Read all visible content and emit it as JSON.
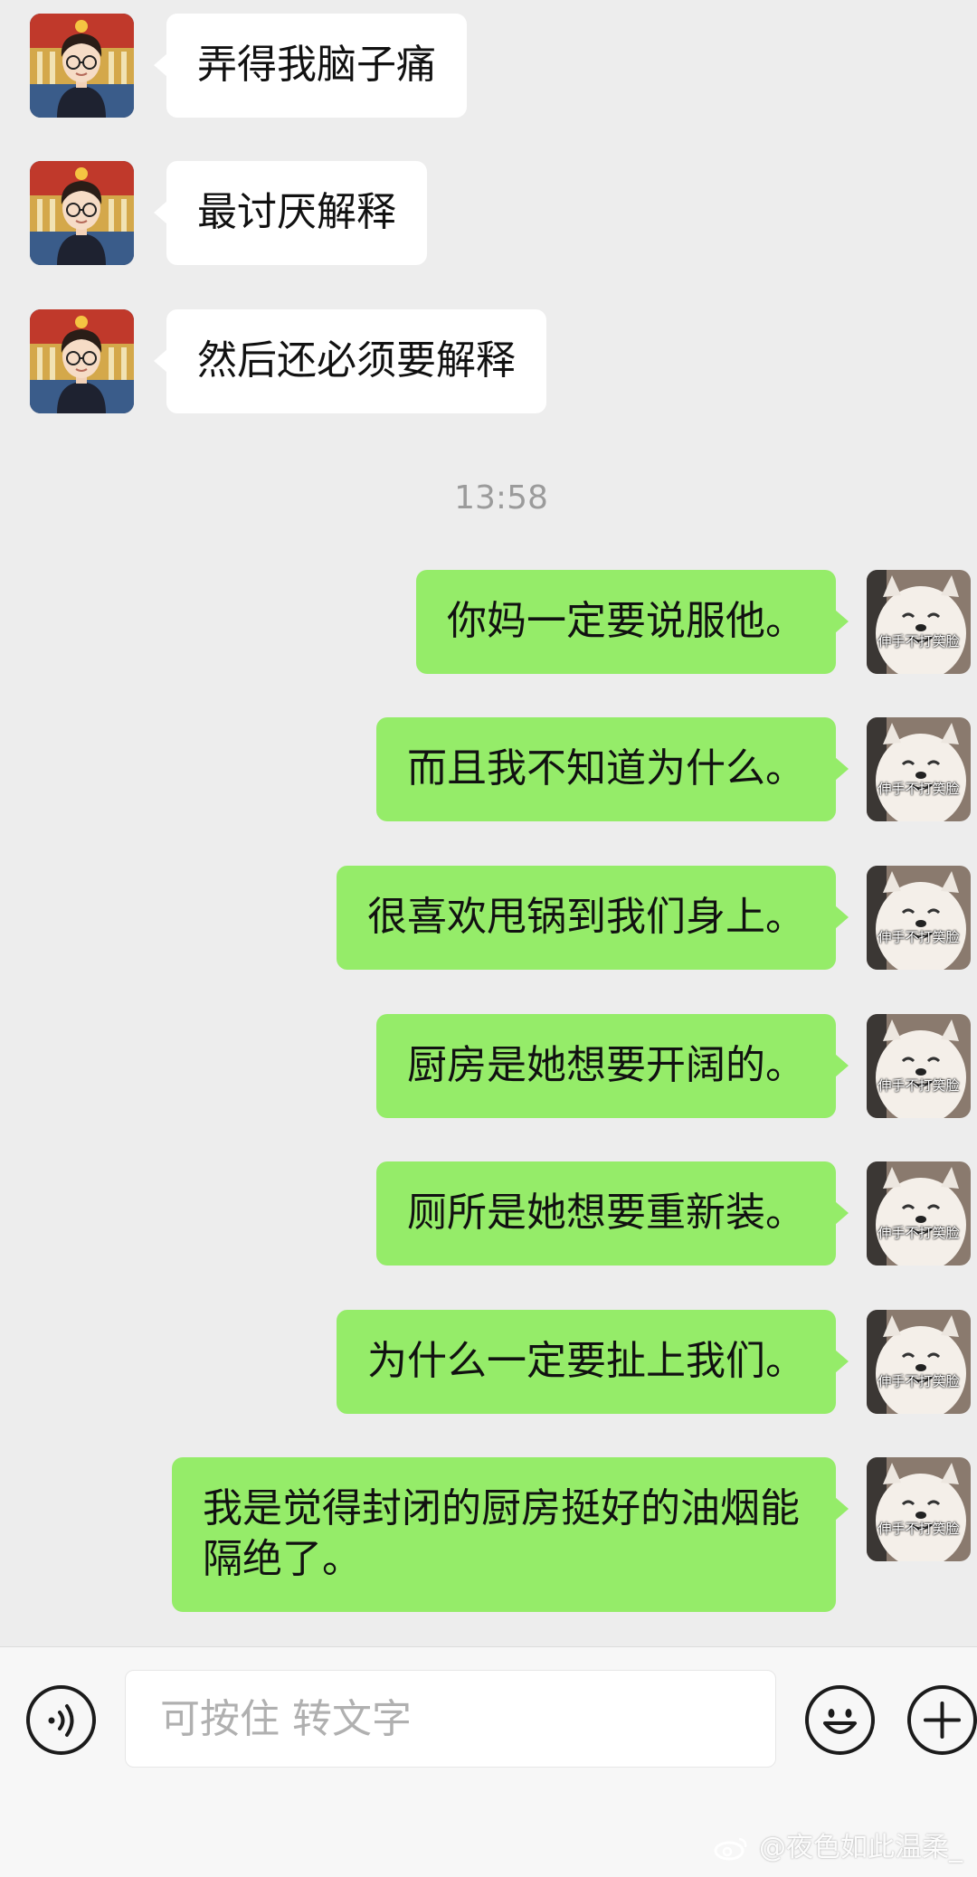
{
  "messages_in": [
    {
      "text": "弄得我脑子痛"
    },
    {
      "text": "最讨厌解释"
    },
    {
      "text": "然后还必须要解释"
    }
  ],
  "timestamp": "13:58",
  "messages_out": [
    {
      "text": "你妈一定要说服他。"
    },
    {
      "text": "而且我不知道为什么。"
    },
    {
      "text": "很喜欢甩锅到我们身上。"
    },
    {
      "text": "厨房是她想要开阔的。"
    },
    {
      "text": "厕所是她想要重新装。"
    },
    {
      "text": "为什么一定要扯上我们。"
    },
    {
      "text": "我是觉得封闭的厨房挺好的油烟能隔绝了。"
    }
  ],
  "avatar_caption": "伸手不打笑脸",
  "input": {
    "placeholder": "可按住 转文字"
  },
  "watermark": "@夜色如此温柔_",
  "icons": {
    "voice": "voice-icon",
    "emoji": "emoji-icon",
    "add": "plus-icon",
    "weibo": "weibo-logo-icon"
  },
  "colors": {
    "outgoing_bubble": "#95ec69",
    "incoming_bubble": "#ffffff",
    "background": "#ededed"
  }
}
